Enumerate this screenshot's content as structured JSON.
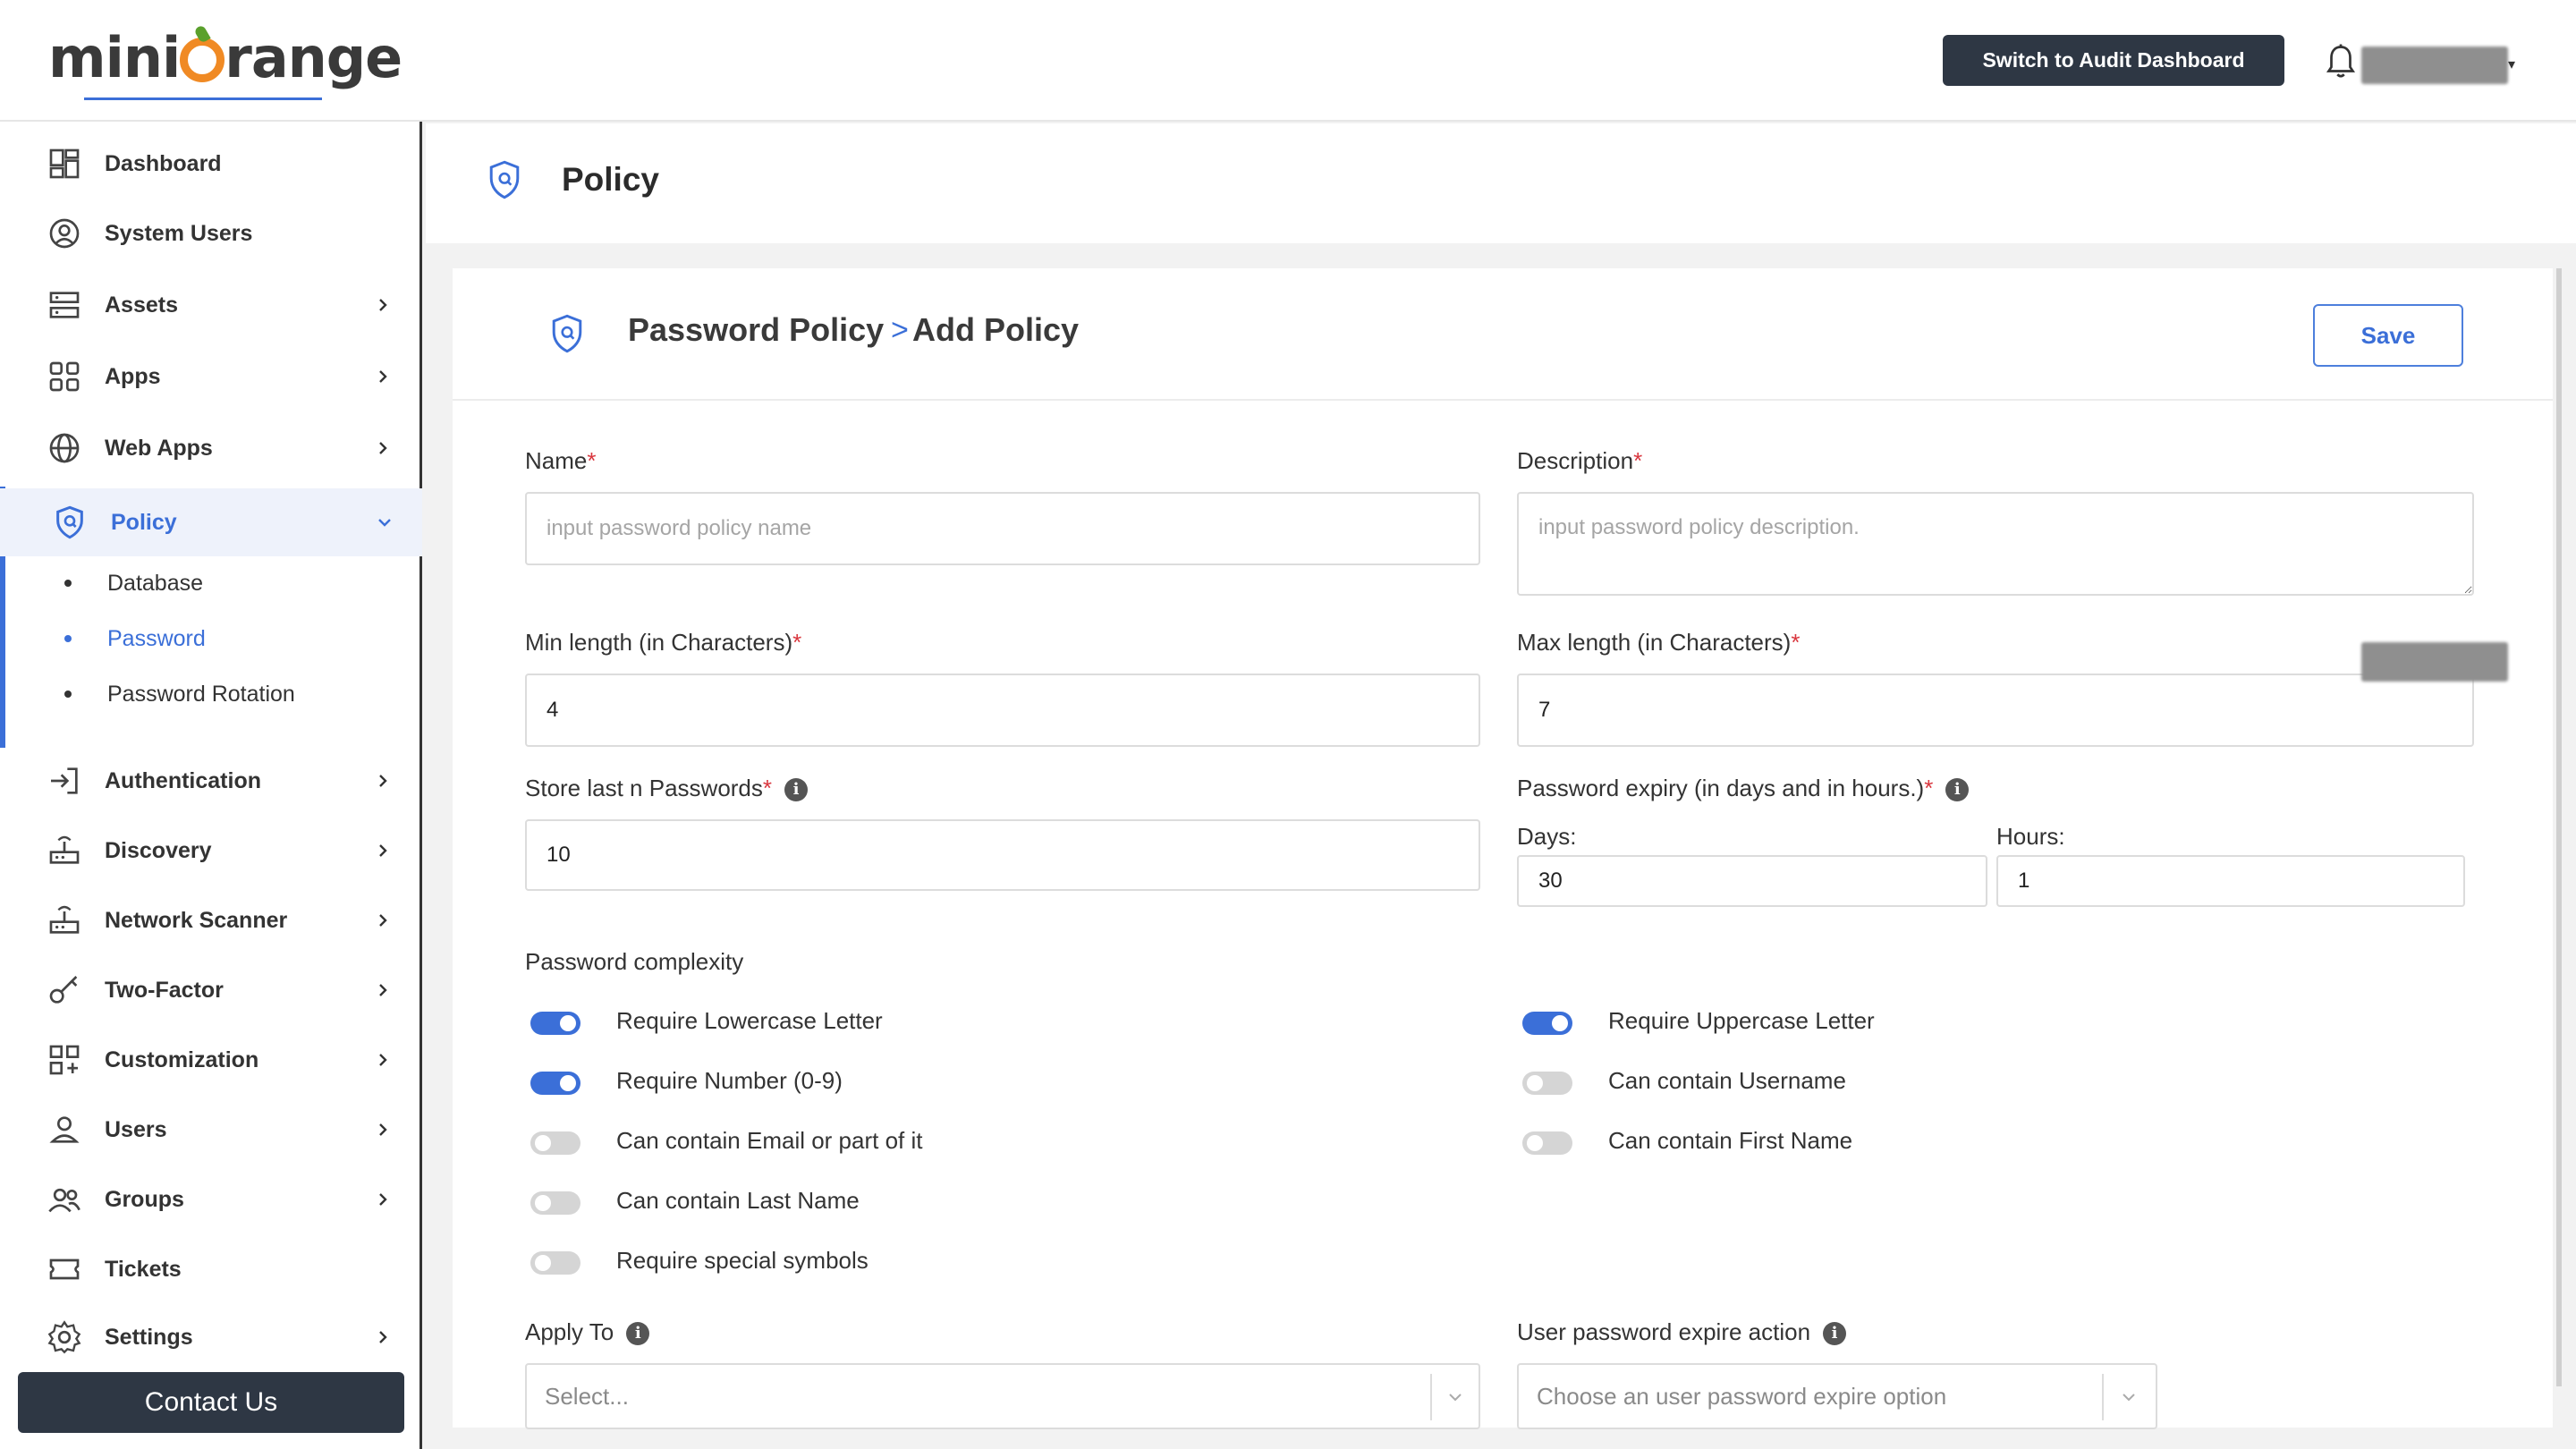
{
  "header": {
    "logo_text_pre": "mini",
    "logo_text_post": "range",
    "audit_button": "Switch to Audit Dashboard"
  },
  "sidebar": {
    "items": [
      {
        "label": "Dashboard",
        "icon": "dashboard-icon",
        "chevron": false
      },
      {
        "label": "System Users",
        "icon": "user-circle-icon",
        "chevron": false
      },
      {
        "label": "Assets",
        "icon": "server-icon",
        "chevron": true
      },
      {
        "label": "Apps",
        "icon": "apps-grid-icon",
        "chevron": true
      },
      {
        "label": "Web Apps",
        "icon": "globe-icon",
        "chevron": true
      },
      {
        "label": "Policy",
        "icon": "shield-icon",
        "chevron": true,
        "active": true
      },
      {
        "label": "Authentication",
        "icon": "login-icon",
        "chevron": true
      },
      {
        "label": "Discovery",
        "icon": "router-icon",
        "chevron": true
      },
      {
        "label": "Network Scanner",
        "icon": "network-icon",
        "chevron": true
      },
      {
        "label": "Two-Factor",
        "icon": "key-icon",
        "chevron": true
      },
      {
        "label": "Customization",
        "icon": "customize-icon",
        "chevron": true
      },
      {
        "label": "Users",
        "icon": "user-icon",
        "chevron": true
      },
      {
        "label": "Groups",
        "icon": "group-icon",
        "chevron": true
      },
      {
        "label": "Tickets",
        "icon": "ticket-icon",
        "chevron": false
      },
      {
        "label": "Settings",
        "icon": "gear-icon",
        "chevron": true
      }
    ],
    "policy_sub": [
      "Database",
      "Password",
      "Password Rotation"
    ],
    "contact": "Contact Us"
  },
  "page": {
    "title": "Policy"
  },
  "card": {
    "crumb_parent": "Password Policy",
    "crumb_sep": ">",
    "crumb_current": "Add Policy",
    "save": "Save"
  },
  "form": {
    "name_label": "Name",
    "name_placeholder": "input password policy name",
    "desc_label": "Description",
    "desc_placeholder": "input password policy description.",
    "min_label": "Min length (in Characters)",
    "min_value": "4",
    "max_label": "Max length (in Characters)",
    "max_value": "7",
    "store_label": "Store last n Passwords",
    "store_value": "10",
    "expiry_label": "Password expiry (in days and in hours.)",
    "days_label": "Days:",
    "days_value": "30",
    "hours_label": "Hours:",
    "hours_value": "1",
    "required_mark": "*",
    "info_glyph": "i",
    "complexity_label": "Password complexity",
    "toggles_left": [
      {
        "label": "Require Lowercase Letter",
        "on": true
      },
      {
        "label": "Require Number (0-9)",
        "on": true
      },
      {
        "label": "Can contain Email or part of it",
        "on": false
      },
      {
        "label": "Can contain Last Name",
        "on": false
      },
      {
        "label": "Require special symbols",
        "on": false
      }
    ],
    "toggles_right": [
      {
        "label": "Require Uppercase Letter",
        "on": true
      },
      {
        "label": "Can contain Username",
        "on": false
      },
      {
        "label": "Can contain First Name",
        "on": false
      }
    ],
    "apply_label": "Apply To",
    "apply_placeholder": "Select...",
    "expire_action_label": "User password expire action",
    "expire_action_placeholder": "Choose an user password expire option"
  },
  "colors": {
    "accent": "#3b6fd8",
    "dark_button": "#2e3744",
    "required": "#d9363e"
  }
}
